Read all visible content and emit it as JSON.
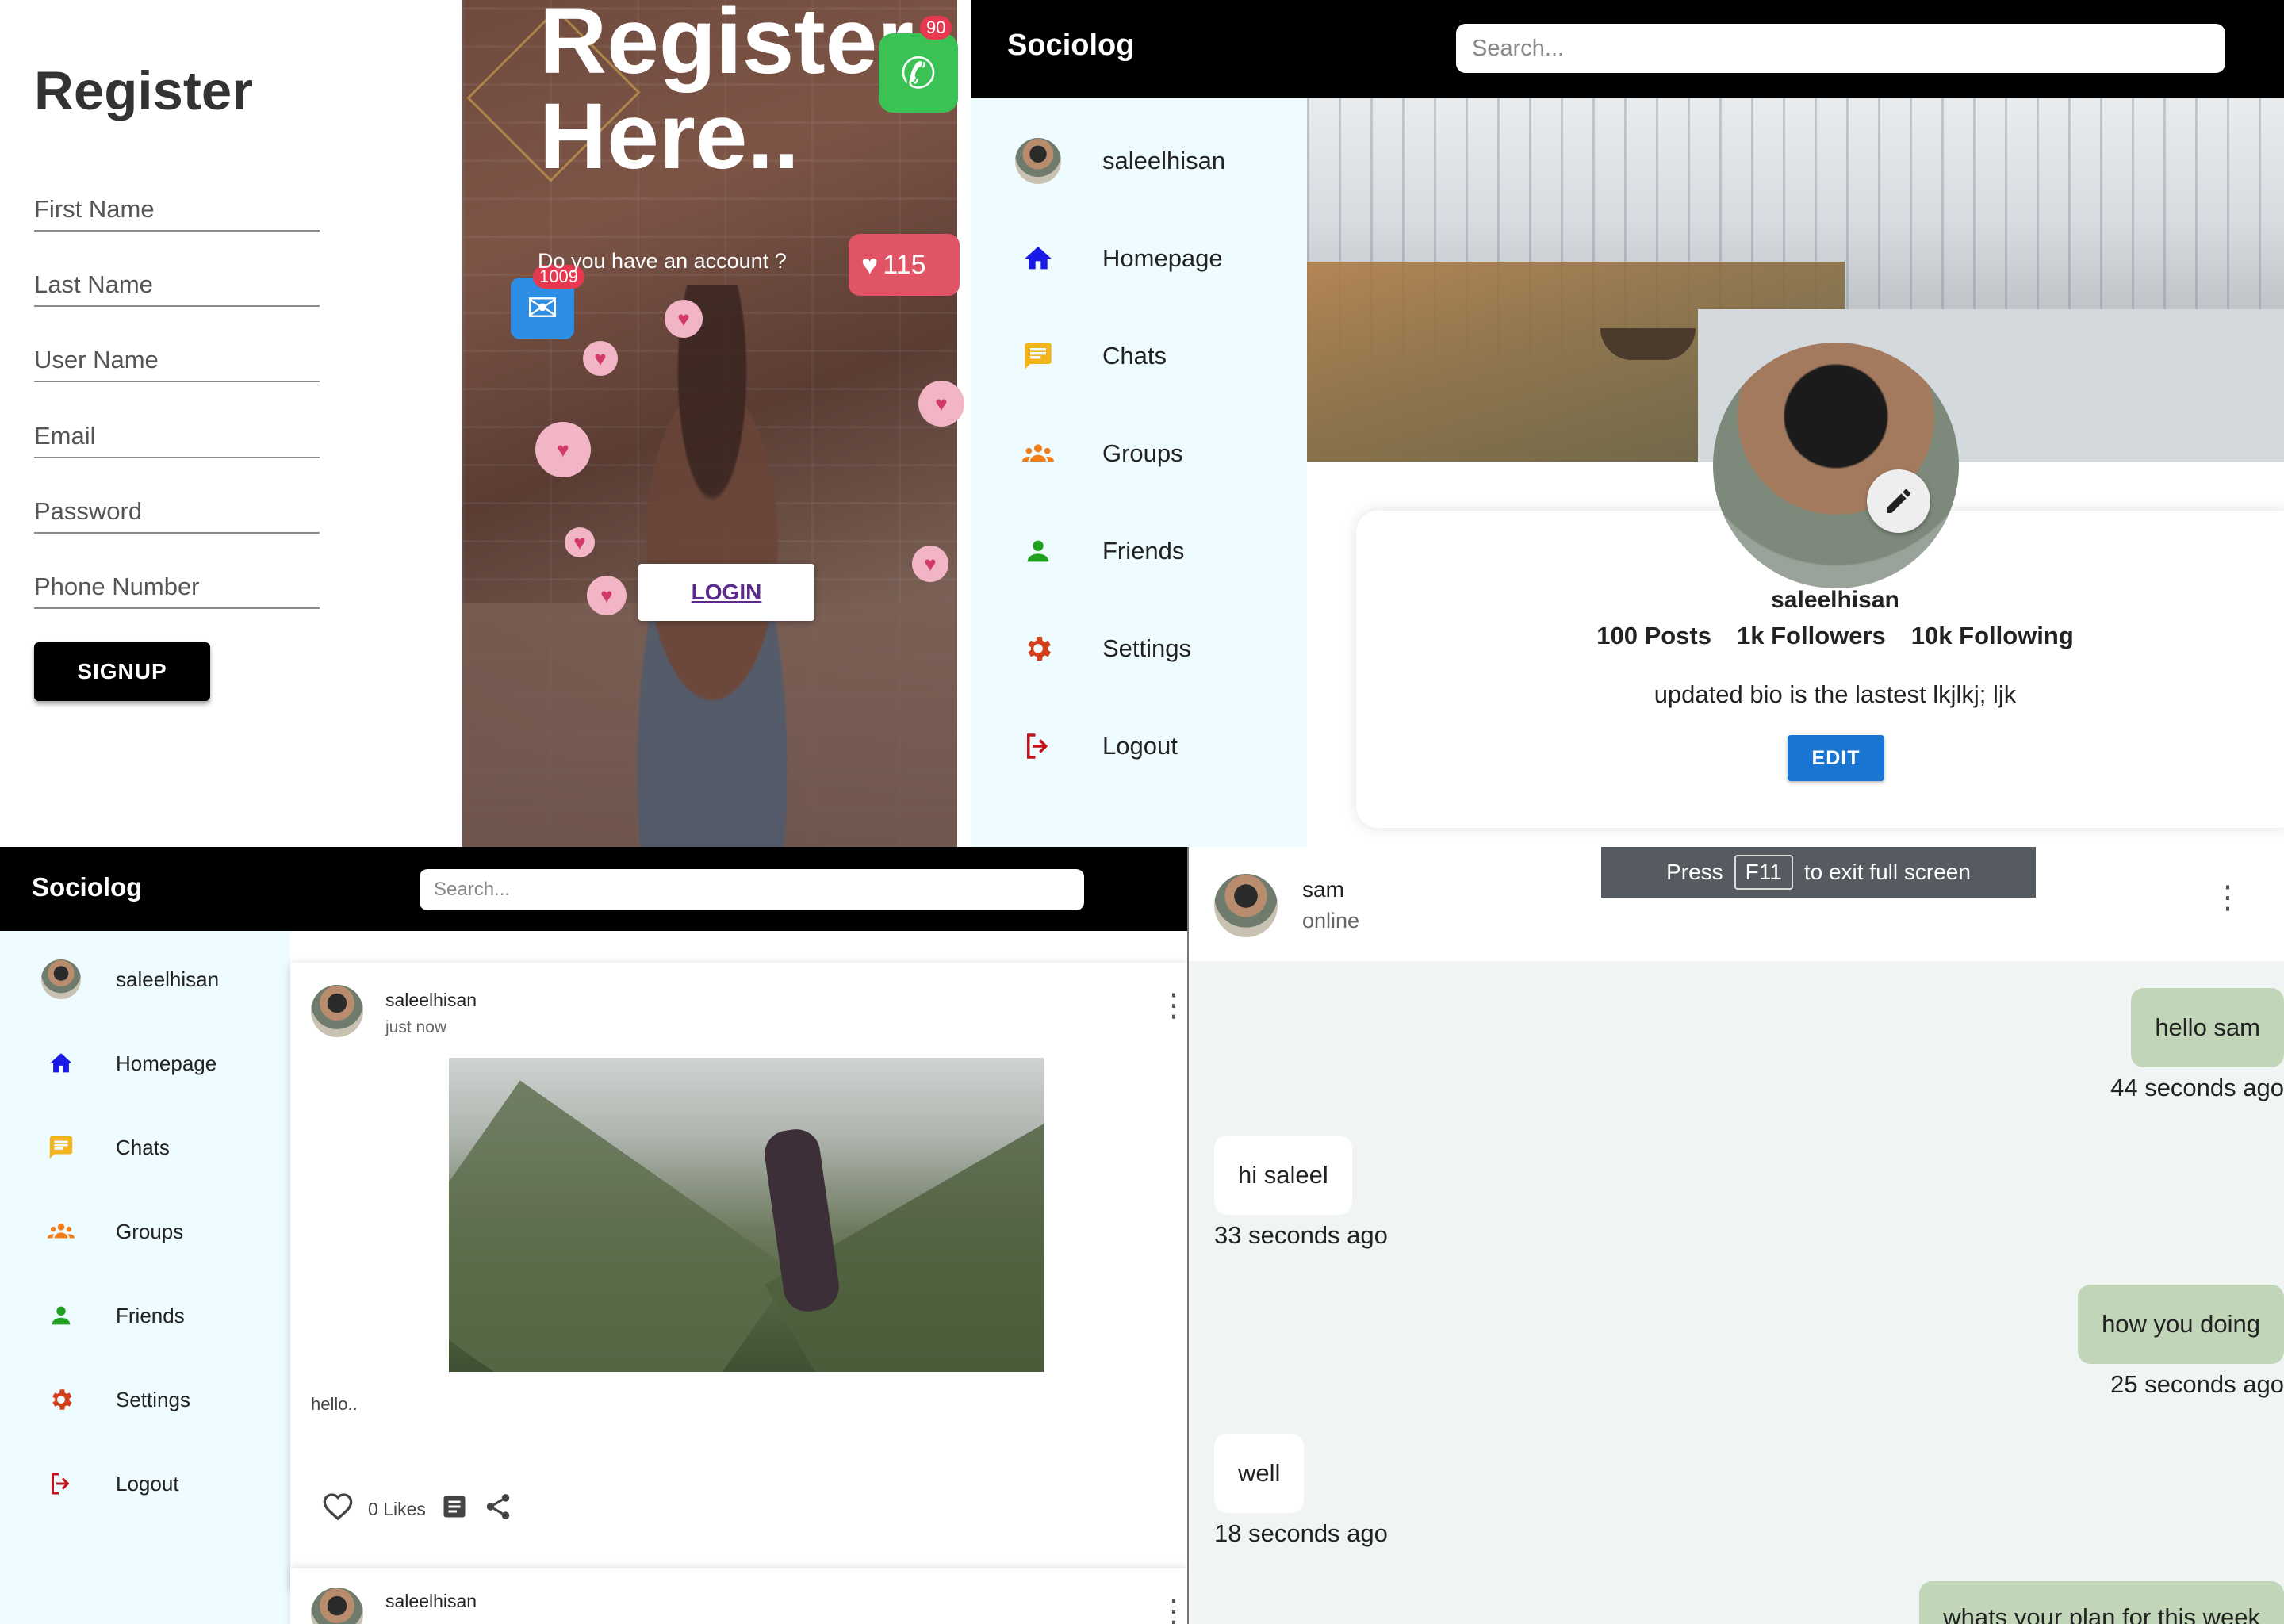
{
  "register": {
    "title": "Register",
    "fields": [
      "First Name",
      "Last Name",
      "User Name",
      "Email",
      "Password",
      "Phone Number"
    ],
    "signup_label": "SIGNUP",
    "hero_title": "Register Here..",
    "account_question": "Do you have an account ?",
    "login_label": "LOGIN",
    "badges": [
      "1009",
      "90",
      "115"
    ]
  },
  "app": {
    "brand": "Sociolog",
    "search_placeholder": "Search..."
  },
  "sidebar": {
    "items": [
      {
        "label": "saleelhisan",
        "icon": "avatar"
      },
      {
        "label": "Homepage",
        "icon": "home-icon",
        "color": "#1a1ae6"
      },
      {
        "label": "Chats",
        "icon": "chat-icon",
        "color": "#f2b31b"
      },
      {
        "label": "Groups",
        "icon": "groups-icon",
        "color": "#f07d1a"
      },
      {
        "label": "Friends",
        "icon": "person-icon",
        "color": "#1fa01f"
      },
      {
        "label": "Settings",
        "icon": "gear-icon",
        "color": "#d2401a"
      },
      {
        "label": "Logout",
        "icon": "logout-icon",
        "color": "#c4121a"
      }
    ]
  },
  "profile": {
    "username": "saleelhisan",
    "posts": "100 Posts",
    "followers": "1k Followers",
    "following": "10k Following",
    "bio": "updated bio is the lastest lkjlkj; ljk",
    "edit_label": "EDIT"
  },
  "feed": {
    "posts": [
      {
        "author": "saleelhisan",
        "time": "just now",
        "text": "hello..",
        "likes": "0 Likes"
      },
      {
        "author": "saleelhisan"
      }
    ]
  },
  "chat": {
    "contact": "sam",
    "status": "online",
    "fullscreen_press": "Press",
    "fullscreen_key": "F11",
    "fullscreen_rest": "to exit full screen",
    "messages": [
      {
        "text": "hello sam",
        "time": "44 seconds ago",
        "dir": "out"
      },
      {
        "text": "hi saleel",
        "time": "33 seconds ago",
        "dir": "in"
      },
      {
        "text": "how you doing",
        "time": "25 seconds ago",
        "dir": "out"
      },
      {
        "text": "well",
        "time": "18 seconds ago",
        "dir": "in"
      },
      {
        "text": "whats your plan for this week",
        "dir": "out"
      }
    ]
  },
  "colors": {
    "accent_blue": "#1976d2",
    "sidebar_bg": "#eefbff",
    "topbar": "#000000",
    "bubble_out": "#c1d6b8"
  }
}
